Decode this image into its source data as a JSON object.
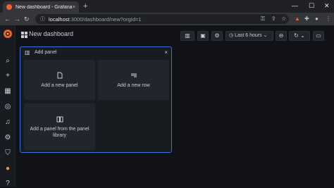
{
  "browser": {
    "tab_title": "New dashboard - Grafana",
    "tab_close": "×",
    "new_tab": "+",
    "url_host": "localhost",
    "url_path": ":3000/dashboard/new?orgId=1",
    "controls": {
      "minimize": "—",
      "maximize": "☐",
      "close": "✕"
    }
  },
  "dashboard": {
    "title": "New dashboard",
    "time_range": "Last 6 hours"
  },
  "add_panel": {
    "title": "Add panel",
    "close": "×",
    "options": [
      {
        "label": "Add a new panel"
      },
      {
        "label": "Add a new row"
      },
      {
        "label": "Add a panel from the panel library"
      }
    ]
  },
  "colors": {
    "accent": "#3d71d9",
    "background": "#111217",
    "panel": "#181b1f",
    "card": "#22252b",
    "brand": "#f2602c"
  }
}
